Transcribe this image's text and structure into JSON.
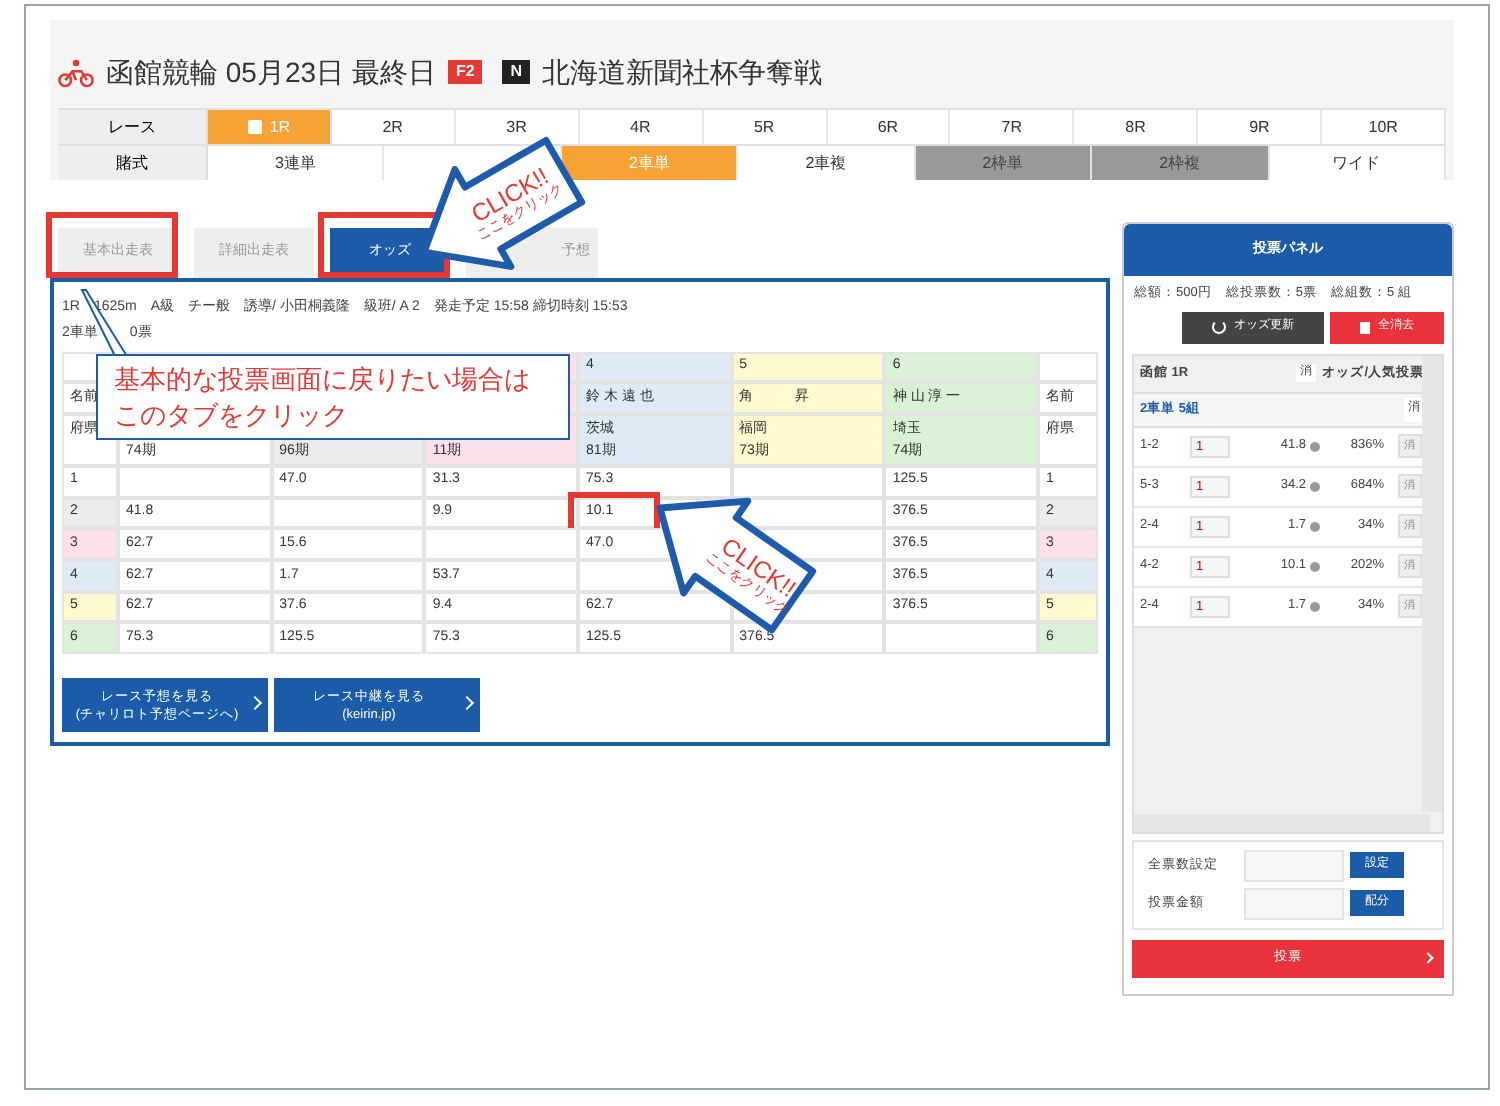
{
  "header": {
    "title": "函館競輪 05月23日 最終日",
    "grade": "F2",
    "badge": "N",
    "race_name": "北海道新聞社杯争奪戦"
  },
  "race_selector": {
    "label": "レース",
    "races": [
      {
        "label": "1R",
        "selected": true
      },
      {
        "label": "2R",
        "selected": false
      },
      {
        "label": "3R",
        "selected": false
      },
      {
        "label": "4R",
        "selected": false
      },
      {
        "label": "5R",
        "selected": false
      },
      {
        "label": "6R",
        "selected": false
      },
      {
        "label": "7R",
        "selected": false
      },
      {
        "label": "8R",
        "selected": false
      },
      {
        "label": "9R",
        "selected": false
      },
      {
        "label": "10R",
        "selected": false
      }
    ]
  },
  "bet_types": {
    "label": "賭式",
    "items": [
      {
        "label": "3連単",
        "selected": false,
        "disabled": false
      },
      {
        "selected": false,
        "disabled": false
      },
      {
        "label": "2車単",
        "selected": true,
        "disabled": false
      },
      {
        "label": "2車複",
        "selected": false,
        "disabled": false
      },
      {
        "label": "2枠単",
        "selected": false,
        "disabled": true
      },
      {
        "label": "2枠複",
        "selected": false,
        "disabled": true
      },
      {
        "label": "ワイド",
        "selected": false,
        "disabled": false
      }
    ]
  },
  "tabs": [
    {
      "label": "基本出走表",
      "selected": false,
      "outlined": true
    },
    {
      "label": "詳細出走表",
      "selected": false,
      "outlined": false
    },
    {
      "label": "オッズ",
      "selected": true,
      "outlined": true
    },
    {
      "label": "予想",
      "selected": false,
      "outlined": false
    }
  ],
  "race_info": "1R　1625m　A級　チー般　誘導/ 小田桐義隆　級班/ A 2　発走予定 15:58 締切時刻 15:53",
  "sales": {
    "label": "2車単",
    "votes": "0票"
  },
  "odds_table": {
    "side_labels": {
      "name": "名前",
      "prefecture": "府県",
      "right_name": "名前",
      "right_prefecture": "府県"
    },
    "columns": [
      {
        "term": "74期",
        "color": "#ffffff"
      },
      {
        "term": "96期",
        "color": "#ebebeb"
      },
      {
        "term": "11期",
        "color": "#fde1e8"
      },
      {
        "number": "4",
        "name": "鈴 木 遠 也",
        "prefecture": "茨城",
        "term": "81期",
        "color": "#deebf7"
      },
      {
        "number": "5",
        "name": "角　　　昇",
        "prefecture": "福岡",
        "term": "73期",
        "color": "#fff9d0"
      },
      {
        "number": "6",
        "name": "神 山 淳 一",
        "prefecture": "埼玉",
        "term": "74期",
        "color": "#d9f1d5"
      }
    ],
    "rows": [
      {
        "number": "1",
        "right_number": "1",
        "color": "#ffffff",
        "cells": [
          {
            "outlined": false
          },
          {
            "value": "47.0",
            "outlined": false
          },
          {
            "value": "31.3",
            "outlined": false
          },
          {
            "value": "75.3",
            "outlined": false
          },
          {
            "outlined": false
          },
          {
            "value": "125.5",
            "outlined": false
          }
        ]
      },
      {
        "number": "2",
        "right_number": "2",
        "color": "#ebebeb",
        "cells": [
          {
            "value": "41.8",
            "outlined": false
          },
          {
            "outlined": false
          },
          {
            "value": "9.9",
            "outlined": false
          },
          {
            "value": "10.1",
            "outlined": true
          },
          {
            "outlined": false
          },
          {
            "value": "376.5",
            "outlined": false
          }
        ]
      },
      {
        "number": "3",
        "right_number": "3",
        "color": "#fde1e8",
        "cells": [
          {
            "value": "62.7",
            "outlined": false
          },
          {
            "value": "15.6",
            "outlined": false
          },
          {
            "outlined": false
          },
          {
            "value": "47.0",
            "outlined": false
          },
          {
            "outlined": false
          },
          {
            "value": "376.5",
            "outlined": false
          }
        ]
      },
      {
        "number": "4",
        "right_number": "4",
        "color": "#deebf7",
        "cells": [
          {
            "value": "62.7",
            "outlined": false
          },
          {
            "value": "1.7",
            "outlined": false
          },
          {
            "value": "53.7",
            "outlined": false
          },
          {
            "outlined": false
          },
          {
            "outlined": false
          },
          {
            "value": "376.5",
            "outlined": false
          }
        ]
      },
      {
        "number": "5",
        "right_number": "5",
        "color": "#fff9d0",
        "cells": [
          {
            "value": "62.7",
            "outlined": false
          },
          {
            "value": "37.6",
            "outlined": false
          },
          {
            "value": "9.4",
            "outlined": false
          },
          {
            "value": "62.7",
            "outlined": false
          },
          {
            "outlined": false
          },
          {
            "value": "376.5",
            "outlined": false
          }
        ]
      },
      {
        "number": "6",
        "right_number": "6",
        "color": "#d9f1d5",
        "cells": [
          {
            "value": "75.3",
            "outlined": false
          },
          {
            "value": "125.5",
            "outlined": false
          },
          {
            "value": "75.3",
            "outlined": false
          },
          {
            "value": "125.5",
            "outlined": false
          },
          {
            "value": "376.5",
            "outlined": false
          },
          {
            "outlined": false
          }
        ]
      }
    ]
  },
  "link_buttons": [
    {
      "lines": [
        "レース予想を見る",
        "(チャリロト予想ページへ)"
      ]
    },
    {
      "lines": [
        "レース中継を見る",
        "(keirin.jp)"
      ]
    }
  ],
  "vote_panel": {
    "title": "投票パネル",
    "summary": "総額：500円　総投票数：5票　総組数：5 組",
    "refresh_button": "オッズ更新",
    "clear_button": "全消去",
    "list_header": {
      "venue": "函館 1R",
      "delete": "消",
      "odds_label": "オッズ/人気投票"
    },
    "group": {
      "label": "2車単 5組",
      "delete": "消"
    },
    "bets": [
      {
        "combo": "1-2",
        "count": "1",
        "odds": "41.8",
        "ratio": "836%",
        "delete": "消"
      },
      {
        "combo": "5-3",
        "count": "1",
        "odds": "34.2",
        "ratio": "684%",
        "delete": "消"
      },
      {
        "combo": "2-4",
        "count": "1",
        "odds": "1.7",
        "ratio": "34%",
        "delete": "消"
      },
      {
        "combo": "4-2",
        "count": "1",
        "odds": "10.1",
        "ratio": "202%",
        "delete": "消"
      },
      {
        "combo": "2-4",
        "count": "1",
        "odds": "1.7",
        "ratio": "34%",
        "delete": "消"
      }
    ],
    "total_setting": {
      "label": "全票数設定",
      "button": "設定"
    },
    "amount": {
      "label": "投票金額",
      "button": "配分"
    },
    "submit": "投票"
  },
  "callouts": [
    {
      "kind": "arrow",
      "lines": [
        "CLICK!!",
        "ここをクリック"
      ]
    },
    {
      "kind": "note",
      "lines": [
        "基本的な投票画面に戻りたい場合は",
        "このタブをクリック"
      ]
    },
    {
      "kind": "arrow",
      "lines": [
        "CLICK!!",
        "ここをクリック"
      ]
    }
  ]
}
